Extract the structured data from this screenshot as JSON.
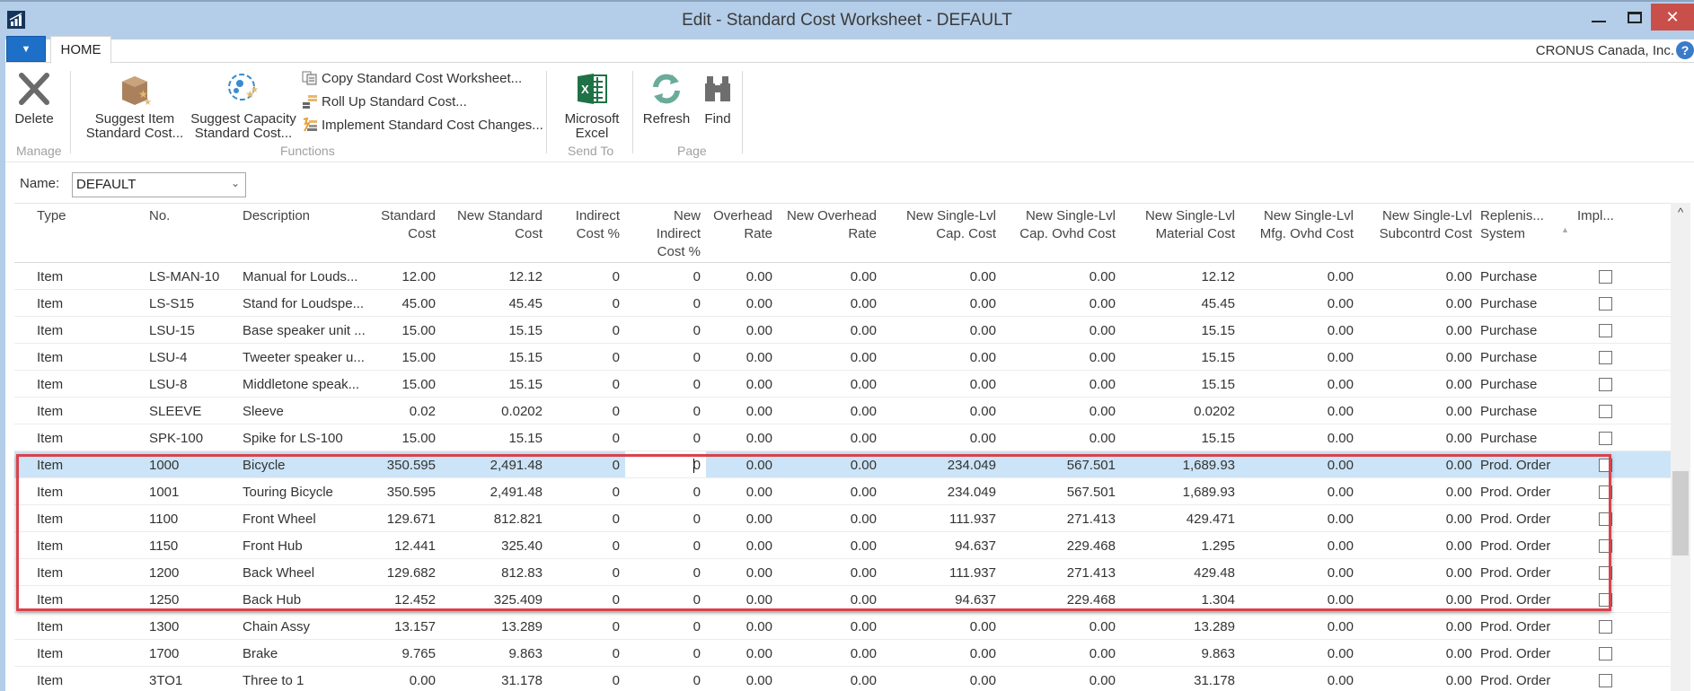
{
  "window": {
    "title": "Edit - Standard Cost Worksheet - DEFAULT",
    "minimize_icon": "minimize-icon",
    "maximize_icon": "maximize-icon",
    "close_glyph": "✕"
  },
  "tabs": {
    "app_menu_glyph": "▼",
    "home": "HOME",
    "company": "CRONUS Canada, Inc.",
    "help_glyph": "?"
  },
  "ribbon": {
    "groups": {
      "manage": "Manage",
      "functions": "Functions",
      "send_to": "Send To",
      "page": "Page"
    },
    "delete": "Delete",
    "suggest_item_1": "Suggest Item",
    "suggest_item_2": "Standard Cost...",
    "suggest_capacity_1": "Suggest Capacity",
    "suggest_capacity_2": "Standard Cost...",
    "copy_worksheet": "Copy Standard Cost Worksheet...",
    "roll_up": "Roll Up Standard Cost...",
    "implement": "Implement Standard Cost Changes...",
    "excel_1": "Microsoft",
    "excel_2": "Excel",
    "refresh": "Refresh",
    "find": "Find"
  },
  "name_filter": {
    "label": "Name:",
    "value": "DEFAULT"
  },
  "grid": {
    "columns": [
      {
        "key": "type",
        "label": [
          "Type"
        ]
      },
      {
        "key": "no",
        "label": [
          "No."
        ]
      },
      {
        "key": "description",
        "label": [
          "Description"
        ]
      },
      {
        "key": "standard_cost",
        "label": [
          "Standard",
          "Cost"
        ]
      },
      {
        "key": "new_standard_cost",
        "label": [
          "New Standard",
          "Cost"
        ]
      },
      {
        "key": "indirect_cost_pct",
        "label": [
          "Indirect",
          "Cost %"
        ]
      },
      {
        "key": "new_indirect_cost_pct",
        "label": [
          "New",
          "Indirect",
          "Cost %"
        ]
      },
      {
        "key": "overhead_rate",
        "label": [
          "Overhead",
          "Rate"
        ]
      },
      {
        "key": "new_overhead_rate",
        "label": [
          "New Overhead",
          "Rate"
        ]
      },
      {
        "key": "new_sl_cap_cost",
        "label": [
          "New Single-Lvl",
          "Cap. Cost"
        ]
      },
      {
        "key": "new_sl_cap_ovhd_cost",
        "label": [
          "New Single-Lvl",
          "Cap. Ovhd Cost"
        ]
      },
      {
        "key": "new_sl_material_cost",
        "label": [
          "New Single-Lvl",
          "Material Cost"
        ]
      },
      {
        "key": "new_sl_mfg_ovhd_cost",
        "label": [
          "New Single-Lvl",
          "Mfg. Ovhd Cost"
        ]
      },
      {
        "key": "new_sl_subcontrd_cost",
        "label": [
          "New Single-Lvl",
          "Subcontrd Cost"
        ]
      },
      {
        "key": "replenishment_system",
        "label": [
          "Replenis...",
          "System"
        ]
      },
      {
        "key": "implemented",
        "label": [
          "Impl..."
        ]
      }
    ],
    "sort_glyph": "▲",
    "selected_row_index": 7,
    "highlighted_rows": [
      7,
      12
    ],
    "rows": [
      [
        "Item",
        "LS-MAN-10",
        "Manual for Louds...",
        "12.00",
        "12.12",
        "0",
        "0",
        "0.00",
        "0.00",
        "0.00",
        "0.00",
        "12.12",
        "0.00",
        "0.00",
        "Purchase",
        false
      ],
      [
        "Item",
        "LS-S15",
        "Stand for Loudspe...",
        "45.00",
        "45.45",
        "0",
        "0",
        "0.00",
        "0.00",
        "0.00",
        "0.00",
        "45.45",
        "0.00",
        "0.00",
        "Purchase",
        false
      ],
      [
        "Item",
        "LSU-15",
        "Base speaker unit ...",
        "15.00",
        "15.15",
        "0",
        "0",
        "0.00",
        "0.00",
        "0.00",
        "0.00",
        "15.15",
        "0.00",
        "0.00",
        "Purchase",
        false
      ],
      [
        "Item",
        "LSU-4",
        "Tweeter speaker u...",
        "15.00",
        "15.15",
        "0",
        "0",
        "0.00",
        "0.00",
        "0.00",
        "0.00",
        "15.15",
        "0.00",
        "0.00",
        "Purchase",
        false
      ],
      [
        "Item",
        "LSU-8",
        "Middletone speak...",
        "15.00",
        "15.15",
        "0",
        "0",
        "0.00",
        "0.00",
        "0.00",
        "0.00",
        "15.15",
        "0.00",
        "0.00",
        "Purchase",
        false
      ],
      [
        "Item",
        "SLEEVE",
        "Sleeve",
        "0.02",
        "0.0202",
        "0",
        "0",
        "0.00",
        "0.00",
        "0.00",
        "0.00",
        "0.0202",
        "0.00",
        "0.00",
        "Purchase",
        false
      ],
      [
        "Item",
        "SPK-100",
        "Spike for LS-100",
        "15.00",
        "15.15",
        "0",
        "0",
        "0.00",
        "0.00",
        "0.00",
        "0.00",
        "15.15",
        "0.00",
        "0.00",
        "Purchase",
        false
      ],
      [
        "Item",
        "1000",
        "Bicycle",
        "350.595",
        "2,491.48",
        "0",
        "0",
        "0.00",
        "0.00",
        "234.049",
        "567.501",
        "1,689.93",
        "0.00",
        "0.00",
        "Prod. Order",
        false
      ],
      [
        "Item",
        "1001",
        "Touring Bicycle",
        "350.595",
        "2,491.48",
        "0",
        "0",
        "0.00",
        "0.00",
        "234.049",
        "567.501",
        "1,689.93",
        "0.00",
        "0.00",
        "Prod. Order",
        false
      ],
      [
        "Item",
        "1100",
        "Front Wheel",
        "129.671",
        "812.821",
        "0",
        "0",
        "0.00",
        "0.00",
        "111.937",
        "271.413",
        "429.471",
        "0.00",
        "0.00",
        "Prod. Order",
        false
      ],
      [
        "Item",
        "1150",
        "Front Hub",
        "12.441",
        "325.40",
        "0",
        "0",
        "0.00",
        "0.00",
        "94.637",
        "229.468",
        "1.295",
        "0.00",
        "0.00",
        "Prod. Order",
        false
      ],
      [
        "Item",
        "1200",
        "Back Wheel",
        "129.682",
        "812.83",
        "0",
        "0",
        "0.00",
        "0.00",
        "111.937",
        "271.413",
        "429.48",
        "0.00",
        "0.00",
        "Prod. Order",
        false
      ],
      [
        "Item",
        "1250",
        "Back Hub",
        "12.452",
        "325.409",
        "0",
        "0",
        "0.00",
        "0.00",
        "94.637",
        "229.468",
        "1.304",
        "0.00",
        "0.00",
        "Prod. Order",
        false
      ],
      [
        "Item",
        "1300",
        "Chain Assy",
        "13.157",
        "13.289",
        "0",
        "0",
        "0.00",
        "0.00",
        "0.00",
        "0.00",
        "13.289",
        "0.00",
        "0.00",
        "Prod. Order",
        false
      ],
      [
        "Item",
        "1700",
        "Brake",
        "9.765",
        "9.863",
        "0",
        "0",
        "0.00",
        "0.00",
        "0.00",
        "0.00",
        "9.863",
        "0.00",
        "0.00",
        "Prod. Order",
        false
      ],
      [
        "Item",
        "3TO1",
        "Three to 1",
        "0.00",
        "31.178",
        "0",
        "0",
        "0.00",
        "0.00",
        "0.00",
        "0.00",
        "31.178",
        "0.00",
        "0.00",
        "Prod. Order",
        false
      ]
    ]
  },
  "scrollbar": {
    "up_glyph": "^",
    "thumb_start_fraction": 0.53,
    "thumb_size_fraction": 0.18
  },
  "colors": {
    "titlebar": "#b4cde8",
    "accent": "#1e6fc8",
    "selection": "#cce4f7",
    "highlight_border": "#d9434c",
    "close_button": "#c9504a"
  }
}
